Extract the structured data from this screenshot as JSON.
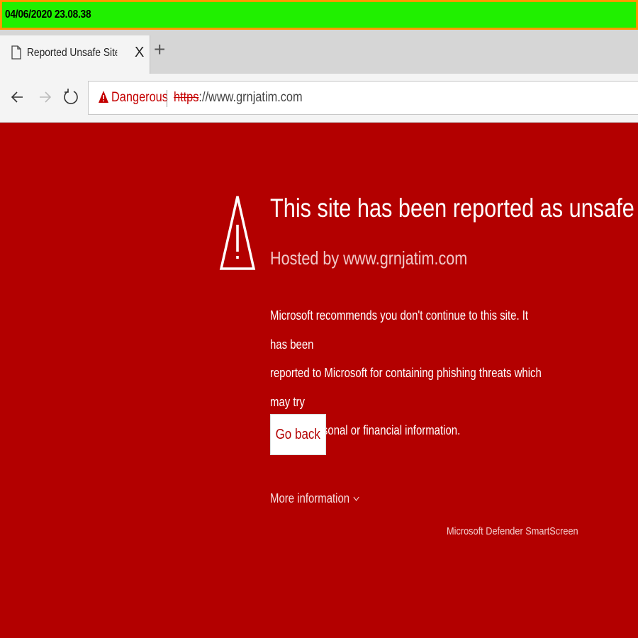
{
  "timestamp_bar": {
    "text": "04/06/2020 23.08.38",
    "color": "#20f000"
  },
  "tab": {
    "title": "Reported Unsafe Site: Navigation",
    "close_label": "X",
    "icon": "page-icon"
  },
  "new_tab": {
    "label": "+"
  },
  "nav": {
    "back_icon": "arrow-left-icon",
    "forward_icon": "arrow-right-icon",
    "refresh_icon": "refresh-icon"
  },
  "address_bar": {
    "security_label": "Dangerous",
    "security_icon": "warning-triangle-icon",
    "url_scheme": "https",
    "url_rest": "://www.grnjatim.com",
    "accent_color": "#c40000"
  },
  "page": {
    "background_color": "#b30000",
    "warning_icon": "warning-triangle-icon",
    "headline": "This site has been reported as unsafe",
    "hosted_by": "Hosted by www.grnjatim.com",
    "line1": "Microsoft recommends you don't continue to this site. It has been",
    "line2": "reported to Microsoft for containing phishing threats which may try",
    "line3": "to steal personal or financial information.",
    "go_back_label": "Go back",
    "more_info_label": "More information",
    "footer": "Microsoft Defender SmartScreen"
  }
}
